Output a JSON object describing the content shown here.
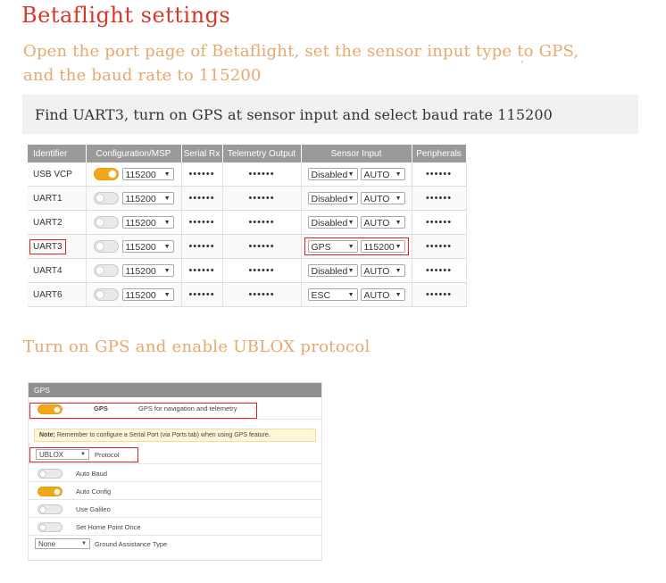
{
  "title": "Betaflight settings",
  "intro_line1": "Open the port page of Betaflight, set the sensor input type to GPS,",
  "intro_line2": "and the baud rate to 115200",
  "stray_mark": "’",
  "instruction": "Find UART3, turn on GPS at sensor input and select baud rate 115200",
  "ports_table": {
    "headers": [
      "Identifier",
      "Configuration/MSP",
      "Serial Rx",
      "Telemetry Output",
      "Sensor Input",
      "Peripherals"
    ],
    "rows": [
      {
        "id": "USB VCP",
        "msp_on": true,
        "msp_baud": "115200",
        "serial_rx": "••••••",
        "telemetry": "••••••",
        "sensor": "Disabled",
        "sensor_baud": "AUTO",
        "peripherals": "••••••",
        "highlight": false
      },
      {
        "id": "UART1",
        "msp_on": false,
        "msp_baud": "115200",
        "serial_rx": "••••••",
        "telemetry": "••••••",
        "sensor": "Disabled",
        "sensor_baud": "AUTO",
        "peripherals": "••••••",
        "highlight": false
      },
      {
        "id": "UART2",
        "msp_on": false,
        "msp_baud": "115200",
        "serial_rx": "••••••",
        "telemetry": "••••••",
        "sensor": "Disabled",
        "sensor_baud": "AUTO",
        "peripherals": "••••••",
        "highlight": false
      },
      {
        "id": "UART3",
        "msp_on": false,
        "msp_baud": "115200",
        "serial_rx": "••••••",
        "telemetry": "••••••",
        "sensor": "GPS",
        "sensor_baud": "115200",
        "peripherals": "••••••",
        "highlight": true
      },
      {
        "id": "UART4",
        "msp_on": false,
        "msp_baud": "115200",
        "serial_rx": "••••••",
        "telemetry": "••••••",
        "sensor": "Disabled",
        "sensor_baud": "AUTO",
        "peripherals": "••••••",
        "highlight": false
      },
      {
        "id": "UART6",
        "msp_on": false,
        "msp_baud": "115200",
        "serial_rx": "••••••",
        "telemetry": "••••••",
        "sensor": "ESC",
        "sensor_baud": "AUTO",
        "peripherals": "••••••",
        "highlight": false
      }
    ]
  },
  "subtitle2": "Turn on GPS and enable UBLOX protocol",
  "gps_panel": {
    "header": "GPS",
    "gps_toggle_on": true,
    "gps_label": "GPS",
    "gps_desc": "GPS for navigation and telemetry",
    "note_bold": "Note:",
    "note_text": " Remember to configure a Serial Port (via Ports tab) when using GPS feature.",
    "protocol_value": "UBLOX",
    "protocol_label": "Protocol",
    "options": [
      {
        "label": "Auto Baud",
        "on": false
      },
      {
        "label": "Auto Config",
        "on": true
      },
      {
        "label": "Use Galileo",
        "on": false
      },
      {
        "label": "Set Home Point Once",
        "on": false
      }
    ],
    "assist_value": "None",
    "assist_label": "Ground Assistance Type"
  },
  "colors": {
    "title": "#d9362a",
    "subtitle": "#e4a96f",
    "toggle_on": "#f0a818",
    "highlight": "#dd2222"
  }
}
